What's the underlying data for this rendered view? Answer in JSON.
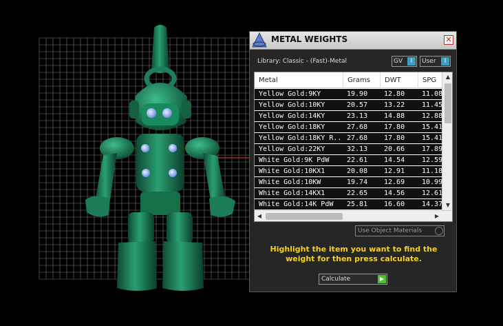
{
  "panel": {
    "title": "METAL WEIGHTS",
    "close_glyph": "✕",
    "library_label": "Library: Classic - (Fast)-Metal",
    "gv_label": "GV",
    "user_label": "User",
    "toggle_indicator": "I",
    "use_object_label": "Use Object Materials",
    "hint": "Highlight the item you want to find the weight for then press calculate.",
    "calculate_label": "Calculate",
    "calculate_glyph": "▶"
  },
  "table": {
    "columns": [
      "Metal",
      "Grams",
      "DWT",
      "SPG"
    ],
    "rows": [
      {
        "metal": "Yellow Gold:9KY",
        "grams": "19.90",
        "dwt": "12.80",
        "spg": "11.08"
      },
      {
        "metal": "Yellow Gold:10KY",
        "grams": "20.57",
        "dwt": "13.22",
        "spg": "11.45"
      },
      {
        "metal": "Yellow Gold:14KY",
        "grams": "23.13",
        "dwt": "14.88",
        "spg": "12.88"
      },
      {
        "metal": "Yellow Gold:18KY",
        "grams": "27.68",
        "dwt": "17.80",
        "spg": "15.41"
      },
      {
        "metal": "Yellow Gold:18KY R...",
        "grams": "27.68",
        "dwt": "17.80",
        "spg": "15.41"
      },
      {
        "metal": "Yellow Gold:22KY",
        "grams": "32.13",
        "dwt": "20.66",
        "spg": "17.89"
      },
      {
        "metal": "White Gold:9K PdW",
        "grams": "22.61",
        "dwt": "14.54",
        "spg": "12.59"
      },
      {
        "metal": "White Gold:10KX1",
        "grams": "20.08",
        "dwt": "12.91",
        "spg": "11.18"
      },
      {
        "metal": "White Gold:10KW",
        "grams": "19.74",
        "dwt": "12.69",
        "spg": "10.99"
      },
      {
        "metal": "White Gold:14KX1",
        "grams": "22.65",
        "dwt": "14.56",
        "spg": "12.61"
      },
      {
        "metal": "White Gold:14K PdW",
        "grams": "25.81",
        "dwt": "16.60",
        "spg": "14.37"
      }
    ],
    "scroll_up": "▲",
    "scroll_down": "▼",
    "scroll_left": "◀",
    "scroll_right": "▶"
  },
  "colors": {
    "model": "#1a7a56",
    "hint": "#f5d21c",
    "grid": "#777777",
    "axis_red": "#c0392b",
    "indicator_blue": "#3c9fbf"
  },
  "icons": {
    "logo": "rhino-logo-icon",
    "close": "close-icon",
    "go": "play-arrow-icon"
  }
}
